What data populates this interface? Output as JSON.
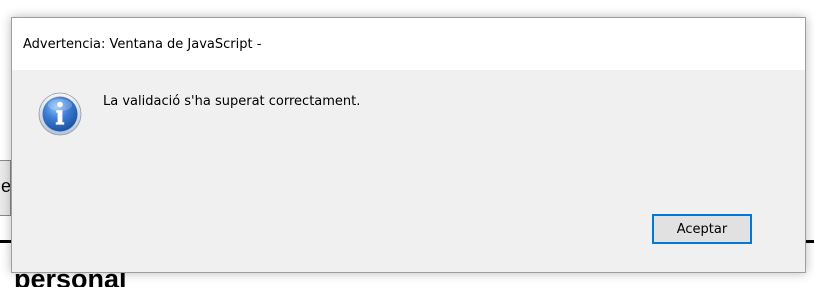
{
  "background": {
    "box_text": "e",
    "heading_text": "personal"
  },
  "dialog": {
    "title": "Advertencia: Ventana de JavaScript -",
    "icon": "information-icon",
    "message": "La validació s'ha superat correctament.",
    "ok_label": "Aceptar"
  },
  "colors": {
    "dialog_body": "#f0f0f0",
    "titlebar": "#ffffff",
    "button_focus_border": "#0078d7",
    "icon_blue": "#2b63b8"
  }
}
